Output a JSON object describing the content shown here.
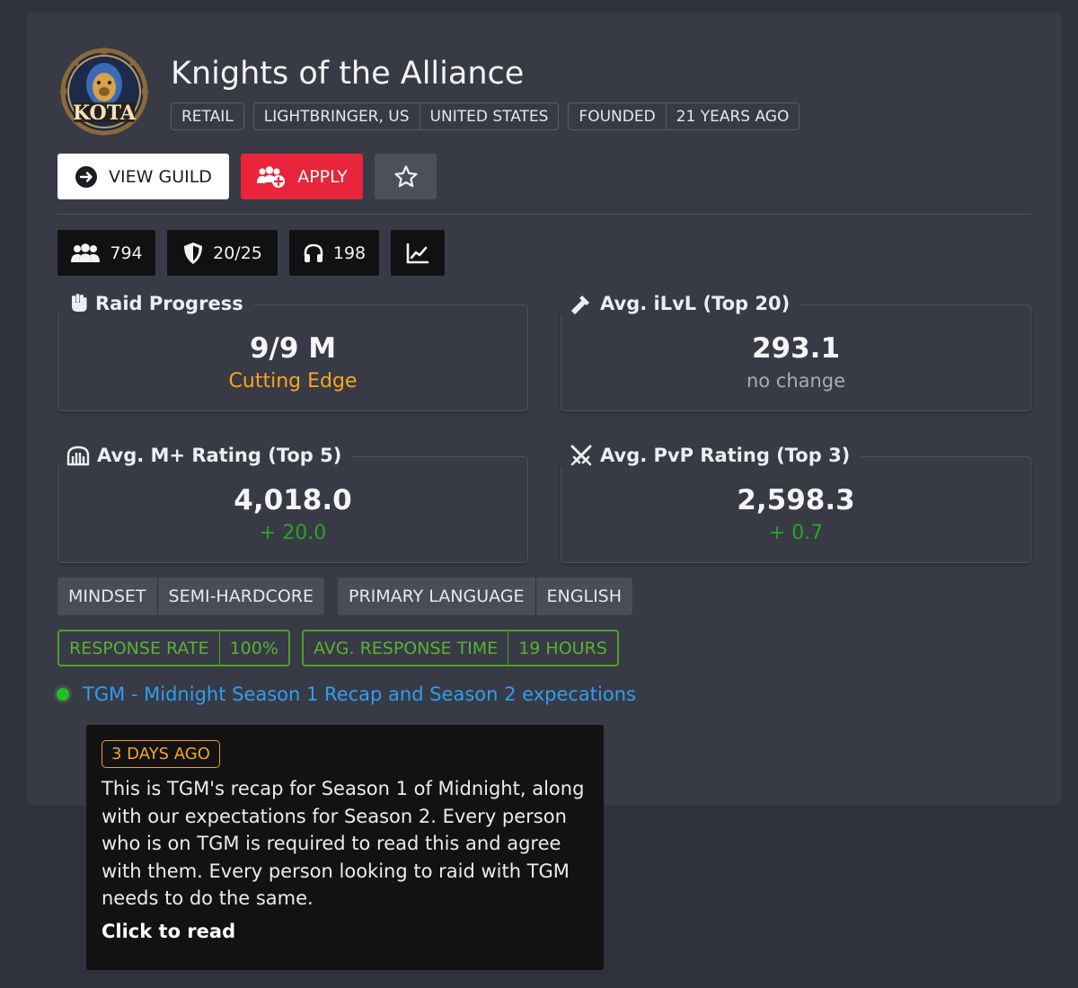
{
  "guild": {
    "logo_text": "KOTA",
    "name": "Knights of the Alliance",
    "tags": [
      [
        "RETAIL"
      ],
      [
        "LIGHTBRINGER, US",
        "UNITED STATES"
      ],
      [
        "FOUNDED",
        "21 YEARS AGO"
      ]
    ]
  },
  "actions": {
    "view_label": "VIEW GUILD",
    "apply_label": "APPLY",
    "view_icon": "arrow-right-circle-icon",
    "apply_icon": "user-group-plus-icon",
    "favorite_icon": "star-icon"
  },
  "stats": {
    "members": "794",
    "raid_team": "20/25",
    "voice": "198",
    "chart_icon": "line-chart-icon"
  },
  "metrics": {
    "raid": {
      "title": "Raid Progress",
      "value": "9/9 M",
      "sub": "Cutting Edge",
      "icon": "fist-icon"
    },
    "ilvl": {
      "title": "Avg. iLvL (Top 20)",
      "value": "293.1",
      "sub": "no change",
      "icon": "hammer-icon"
    },
    "mplus": {
      "title": "Avg. M+ Rating (Top 5)",
      "value": "4,018.0",
      "sub": "+ 20.0",
      "icon": "keystone-icon"
    },
    "pvp": {
      "title": "Avg. PvP Rating (Top 3)",
      "value": "2,598.3",
      "sub": "+ 0.7",
      "icon": "crossed-swords-icon"
    }
  },
  "info": {
    "mindset_label": "MINDSET",
    "mindset_value": "SEMI-HARDCORE",
    "language_label": "PRIMARY LANGUAGE",
    "language_value": "ENGLISH",
    "response_rate_label": "RESPONSE RATE",
    "response_rate_value": "100%",
    "response_time_label": "AVG. RESPONSE TIME",
    "response_time_value": "19 HOURS"
  },
  "post": {
    "title": "TGM - Midnight Season 1 Recap and Season 2 expecations",
    "age": "3 DAYS AGO",
    "body": "This is TGM's recap for Season 1 of Midnight, along with our expectations for Season 2. Every person who is on TGM is required to read this and agree with them. Every person looking to raid with TGM needs to do the same.",
    "cta": "Click to read"
  },
  "colors": {
    "apply": "#e8253a",
    "cutting_edge": "#f5a623",
    "positive": "#27a327",
    "link": "#2e9ff0",
    "response_green": "#4aa32a"
  }
}
